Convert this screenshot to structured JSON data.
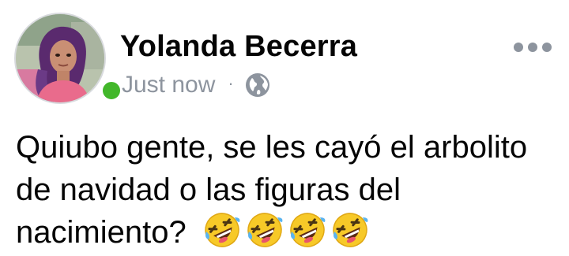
{
  "post": {
    "author_name": "Yolanda Becerra",
    "timestamp": "Just now",
    "separator": "·",
    "privacy_icon": "globe-icon",
    "text": "Quiubo gente, se les cayó el arbolito de navidad o las figuras del nacimiento?",
    "emojis": [
      "rolling-on-floor-laughing",
      "rolling-on-floor-laughing",
      "rolling-on-floor-laughing",
      "rolling-on-floor-laughing"
    ],
    "online_status": "online",
    "colors": {
      "online": "#42b72a",
      "meta_text": "#8d949e",
      "text": "#050505"
    }
  }
}
